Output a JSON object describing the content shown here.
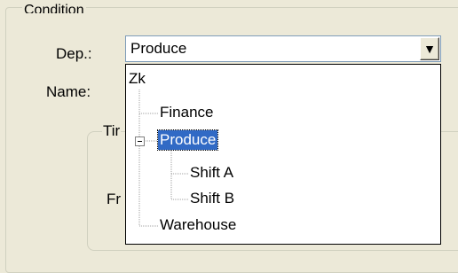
{
  "condition": {
    "legend": "Condition",
    "dep_label": "Dep.:",
    "name_label": "Name:",
    "dep_value": "Produce",
    "dropdown_arrow": "▼"
  },
  "time_group": {
    "legend": "Tir",
    "from_label": "Fr"
  },
  "tree": {
    "root": "Zk",
    "items": [
      {
        "label": "Finance",
        "level": 1,
        "selected": false
      },
      {
        "label": "Produce",
        "level": 1,
        "selected": true,
        "expanded": true
      },
      {
        "label": "Shift A",
        "level": 2,
        "selected": false
      },
      {
        "label": "Shift B",
        "level": 2,
        "selected": false
      },
      {
        "label": "Warehouse",
        "level": 1,
        "selected": false
      }
    ]
  },
  "colors": {
    "background": "#ece9d8",
    "selection": "#316ac5",
    "combo_border": "#7f9db9"
  }
}
